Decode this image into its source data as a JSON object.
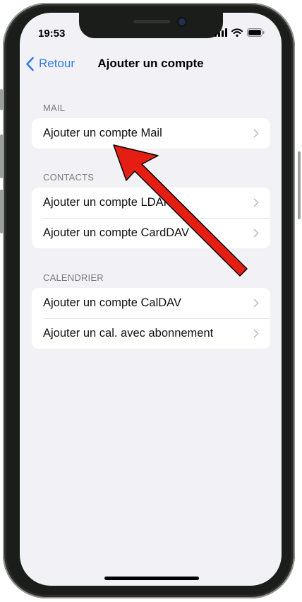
{
  "status_bar": {
    "time": "19:53"
  },
  "nav": {
    "back_label": "Retour",
    "title": "Ajouter un compte"
  },
  "sections": [
    {
      "header": "MAIL",
      "items": [
        {
          "label": "Ajouter un compte Mail"
        }
      ]
    },
    {
      "header": "CONTACTS",
      "items": [
        {
          "label": "Ajouter un compte LDAP"
        },
        {
          "label": "Ajouter un compte CardDAV"
        }
      ]
    },
    {
      "header": "CALENDRIER",
      "items": [
        {
          "label": "Ajouter un compte CalDAV"
        },
        {
          "label": "Ajouter un cal. avec abonnement"
        }
      ]
    }
  ],
  "colors": {
    "accent": "#2f7bf0",
    "background": "#f2f1f6",
    "annotation_arrow": "#e41e12"
  },
  "icons": {
    "back": "chevron-left-icon",
    "row_disclosure": "chevron-right-icon",
    "signal": "cellular-signal-icon",
    "wifi": "wifi-icon",
    "battery": "battery-icon"
  }
}
